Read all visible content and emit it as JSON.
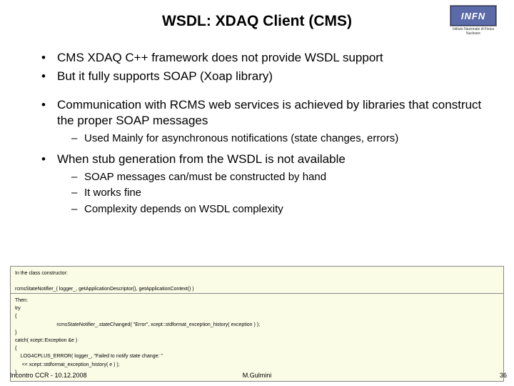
{
  "title": "WSDL: XDAQ Client (CMS)",
  "logo": {
    "text": "INFN",
    "caption": "Istituto Nazionale di Fisica Nucleare"
  },
  "bullets": {
    "b1": "CMS XDAQ C++ framework does not provide WSDL support",
    "b2": "But it fully supports SOAP (Xoap library)",
    "b3": "Communication with RCMS web services is achieved by libraries that construct the proper SOAP messages",
    "b3_1": "Used Mainly for asynchronous notifications (state changes, errors)",
    "b4": "When stub generation from the WSDL is not available",
    "b4_1": "SOAP messages can/must be constructed by hand",
    "b4_2": "It works fine",
    "b4_3": "Complexity depends on WSDL complexity"
  },
  "code1": "In the class constructor:\n\nrcmsStateNotifier_( logger_, getApplicationDescriptor(), getApplicationContext() )",
  "code2": "Then:\ntry\n{\n                              rcmsStateNotifier_.stateChanged( \"Error\", xcept::stdformat_exception_history( exception ) );\n}\ncatch( xcept::Exception &e )\n{\n    LOG4CPLUS_ERROR( logger_, \"Failed to notify state change: \"\n     << xcept::stdformat_exception_history( e ) );\n}",
  "footer": {
    "left": "Incontro CCR - 10.12.2008",
    "center": "M.Gulmini",
    "right": "36"
  }
}
